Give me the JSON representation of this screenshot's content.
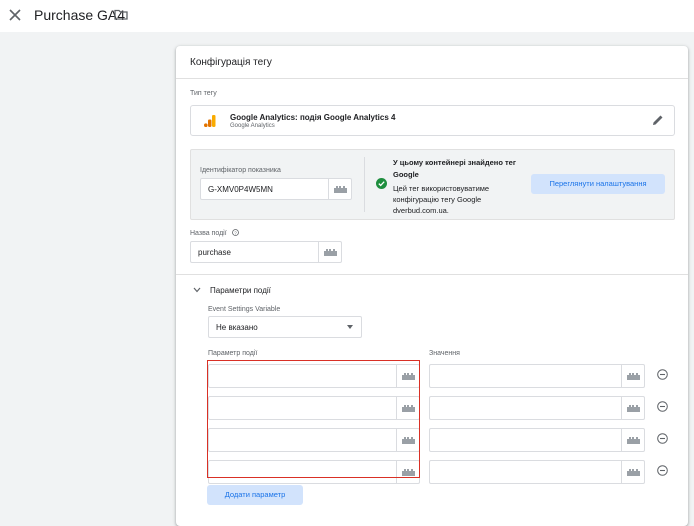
{
  "window": {
    "title": "Purchase GA4"
  },
  "card": {
    "title": "Конфігурація тегу"
  },
  "tag_type": {
    "label": "Тип тегу",
    "name": "Google Analytics: подія Google Analytics 4",
    "vendor": "Google Analytics"
  },
  "google_tag": {
    "id_label": "Ідентифікатор показника",
    "id_value": "G-XMV0P4W5MN",
    "found_title": "У цьому контейнері знайдено тег Google",
    "found_desc": "Цей тег використовуватиме конфігурацію тегу Google dverbud.com.ua.",
    "settings_button": "Переглянути налаштування"
  },
  "event_name": {
    "label": "Назва події",
    "value": "purchase"
  },
  "event_params": {
    "section_title": "Параметри події",
    "settings_var_label": "Event Settings Variable",
    "settings_var_value": "Не вказано",
    "param_col": "Параметр події",
    "value_col": "Значення",
    "rows": [
      {
        "param": "",
        "value": ""
      },
      {
        "param": "",
        "value": ""
      },
      {
        "param": "",
        "value": ""
      },
      {
        "param": "",
        "value": ""
      }
    ],
    "add_button": "Додати параметр"
  },
  "colors": {
    "accent": "#1a73e8",
    "highlight": "#d93025",
    "success": "#1e8e3e",
    "ga_orange": "#f9ab00",
    "ga_dark": "#e37400"
  }
}
